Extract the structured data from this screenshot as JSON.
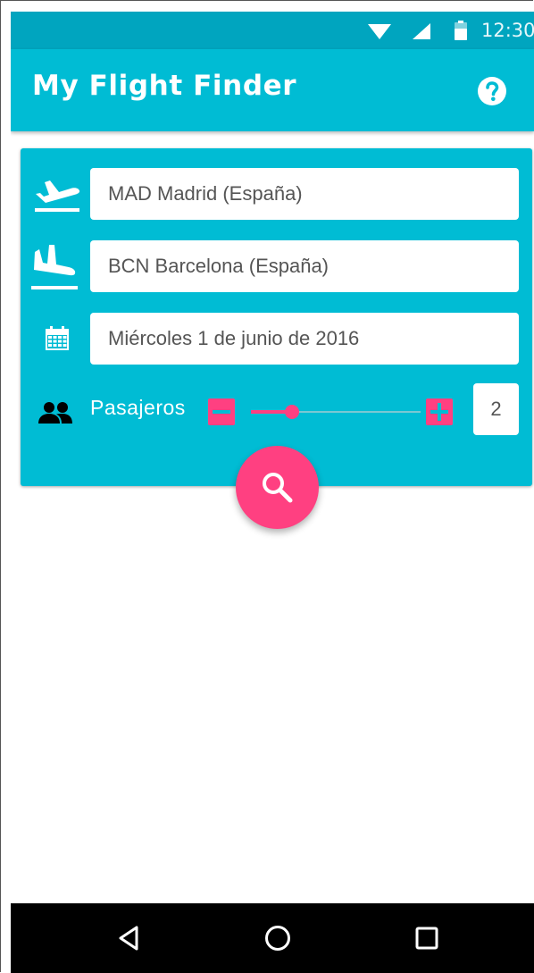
{
  "status_bar": {
    "time": "12:30"
  },
  "app_bar": {
    "title": "My Flight Finder",
    "help_icon": "help-circle-icon"
  },
  "search_form": {
    "origin": {
      "icon": "flight-takeoff-icon",
      "value": "MAD Madrid (España)"
    },
    "destination": {
      "icon": "flight-land-icon",
      "value": "BCN Barcelona (España)"
    },
    "date": {
      "icon": "calendar-icon",
      "value": "Miércoles 1 de junio de 2016"
    },
    "passengers": {
      "icon": "people-icon",
      "label": "Pasajeros",
      "count": "2",
      "slider_fraction": 0.24
    },
    "search_icon": "search-icon"
  },
  "navigation": {
    "back_icon": "back-triangle-icon",
    "home_icon": "home-circle-icon",
    "recents_icon": "recents-square-icon"
  },
  "colors": {
    "primary": "#00bcd4",
    "primary_dark": "#00a5bf",
    "accent": "#ff4081"
  }
}
